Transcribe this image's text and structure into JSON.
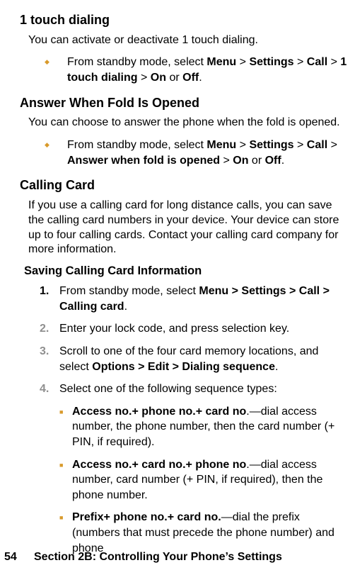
{
  "sections": {
    "oneTouch": {
      "title": "1 touch dialing",
      "intro": "You can activate or deactivate 1 touch dialing.",
      "step_pre": "From standby mode, select ",
      "path": [
        "Menu",
        "Settings",
        "Call",
        "1 touch dialing",
        "On",
        "Off"
      ]
    },
    "answerFold": {
      "title": "Answer When Fold Is Opened",
      "intro": "You can choose to answer the phone when the fold is opened.",
      "step_pre": "From standby mode, select ",
      "path": [
        "Menu",
        "Settings",
        "Call",
        "Answer when fold is opened",
        "On",
        "Off"
      ]
    },
    "callingCard": {
      "title": "Calling Card",
      "intro": "If you use a calling card for long distance calls, you can save the calling card numbers in your device. Your device can store up to four calling cards. Contact your calling card company for more information.",
      "subTitle": "Saving Calling Card Information",
      "steps": {
        "s1_pre": "From standby mode, select ",
        "s1_bold": "Menu > Settings > Call > Calling card",
        "s2": "Enter your lock code, and press selection key.",
        "s3_pre": "Scroll to one of the four card memory locations, and select ",
        "s3_bold": "Options > Edit > Dialing sequence",
        "s4": "Select one of the following sequence types:"
      },
      "seq": {
        "a_bold": "Access no.+ phone no.+ card no",
        "a_rest": ".—dial access number, the phone number, then the card number (+ PIN, if required).",
        "b_bold": "Access no.+ card no.+ phone no",
        "b_rest": ".—dial access number, card number (+ PIN, if required), then the phone number.",
        "c_bold": "Prefix+ phone no.+ card no.",
        "c_rest": "—dial the prefix (numbers that must precede the phone number) and phone"
      }
    }
  },
  "gly": {
    "diamond": "◆",
    "square": "■",
    "sep": " > ",
    "or": " or ",
    "dot": "."
  },
  "num": {
    "n1": "1.",
    "n2": "2.",
    "n3": "3.",
    "n4": "4."
  },
  "footer": {
    "page": "54",
    "title": "Section 2B: Controlling Your Phone’s Settings"
  }
}
